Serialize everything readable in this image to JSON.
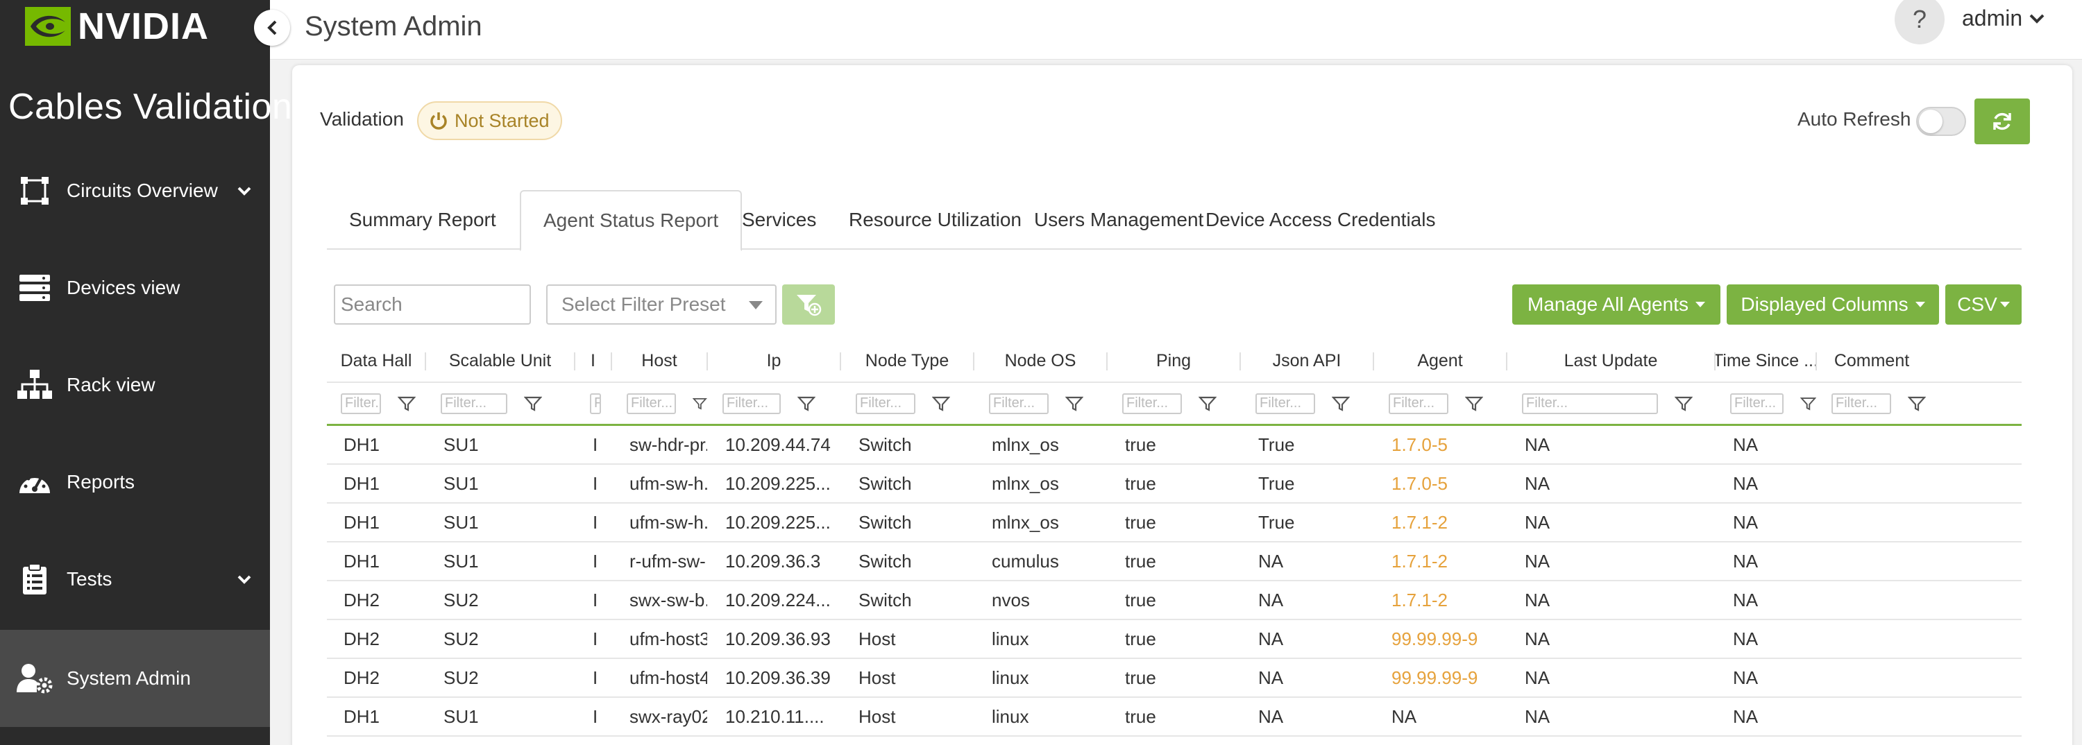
{
  "brand": {
    "wordmark": "NVIDIA",
    "accent": "#76b900",
    "button_green": "#7cb342"
  },
  "sidebar": {
    "app_title": "Cables Validation",
    "items": [
      {
        "label": "Circuits Overview",
        "icon": "circuit-icon",
        "has_chevron": true
      },
      {
        "label": "Devices view",
        "icon": "server-icon",
        "has_chevron": false
      },
      {
        "label": "Rack view",
        "icon": "hierarchy-icon",
        "has_chevron": false
      },
      {
        "label": "Reports",
        "icon": "gauge-icon",
        "has_chevron": false
      },
      {
        "label": "Tests",
        "icon": "clipboard-icon",
        "has_chevron": true
      },
      {
        "label": "System Admin",
        "icon": "user-gear-icon",
        "has_chevron": false,
        "active": true
      }
    ]
  },
  "header": {
    "title": "System Admin",
    "help_label": "?",
    "user": "admin"
  },
  "validation": {
    "label": "Validation",
    "status": "Not Started"
  },
  "auto_refresh": {
    "label": "Auto Refresh",
    "enabled": false
  },
  "tabs": [
    {
      "label": "Summary Report"
    },
    {
      "label": "Agent Status Report",
      "active": true
    },
    {
      "label": "Services"
    },
    {
      "label": "Resource Utilization"
    },
    {
      "label": "Users Management"
    },
    {
      "label": "Device Access Credentials"
    }
  ],
  "toolbar": {
    "search_placeholder": "Search",
    "filter_preset_placeholder": "Select Filter Preset",
    "manage_agents_label": "Manage All Agents",
    "displayed_columns_label": "Displayed Columns",
    "csv_label": "CSV"
  },
  "table": {
    "filter_placeholder": "Filter...",
    "columns": [
      "Data Hall",
      "Scalable Unit",
      "I",
      "Host",
      "Ip",
      "Node Type",
      "Node OS",
      "Ping",
      "Json API",
      "Agent",
      "Last Update",
      "Time Since ...",
      "Comment"
    ],
    "rows": [
      [
        "DH1",
        "SU1",
        "I",
        "sw-hdr-pr...",
        "10.209.44.74",
        "Switch",
        "mlnx_os",
        "true",
        "True",
        "1.7.0-5",
        "NA",
        "NA",
        ""
      ],
      [
        "DH1",
        "SU1",
        "I",
        "ufm-sw-h...",
        "10.209.225...",
        "Switch",
        "mlnx_os",
        "true",
        "True",
        "1.7.0-5",
        "NA",
        "NA",
        ""
      ],
      [
        "DH1",
        "SU1",
        "I",
        "ufm-sw-h...",
        "10.209.225...",
        "Switch",
        "mlnx_os",
        "true",
        "True",
        "1.7.1-2",
        "NA",
        "NA",
        ""
      ],
      [
        "DH1",
        "SU1",
        "I",
        "r-ufm-sw-...",
        "10.209.36.3",
        "Switch",
        "cumulus",
        "true",
        "NA",
        "1.7.1-2",
        "NA",
        "NA",
        ""
      ],
      [
        "DH2",
        "SU2",
        "I",
        "swx-sw-b...",
        "10.209.224...",
        "Switch",
        "nvos",
        "true",
        "NA",
        "1.7.1-2",
        "NA",
        "NA",
        ""
      ],
      [
        "DH2",
        "SU2",
        "I",
        "ufm-host3...",
        "10.209.36.93",
        "Host",
        "linux",
        "true",
        "NA",
        "99.99.99-9",
        "NA",
        "NA",
        ""
      ],
      [
        "DH2",
        "SU2",
        "I",
        "ufm-host4...",
        "10.209.36.39",
        "Host",
        "linux",
        "true",
        "NA",
        "99.99.99-9",
        "NA",
        "NA",
        ""
      ],
      [
        "DH1",
        "SU1",
        "I",
        "swx-ray02...",
        "10.210.11....",
        "Host",
        "linux",
        "true",
        "NA",
        "NA",
        "NA",
        "NA",
        ""
      ]
    ]
  }
}
